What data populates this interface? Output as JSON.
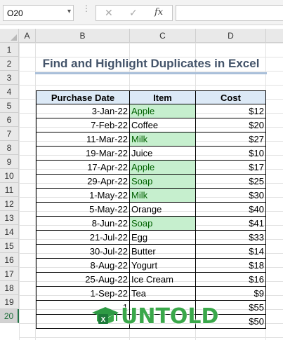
{
  "formula_bar": {
    "name_box": "O20",
    "fx_label": "fx",
    "formula_value": ""
  },
  "columns": [
    "A",
    "B",
    "C",
    "D"
  ],
  "rows": [
    "1",
    "2",
    "3",
    "4",
    "5",
    "6",
    "7",
    "8",
    "9",
    "10",
    "11",
    "12",
    "13",
    "14",
    "15",
    "16",
    "17",
    "18",
    "19",
    "20"
  ],
  "selected_row": "20",
  "sheet": {
    "title": "Find and Highlight Duplicates in Excel",
    "headers": {
      "purchase_date": "Purchase Date",
      "item": "Item",
      "cost": "Cost"
    },
    "records": [
      {
        "date": "3-Jan-22",
        "item": "Apple",
        "cost": "$12",
        "duplicate": true
      },
      {
        "date": "7-Feb-22",
        "item": "Coffee",
        "cost": "$20",
        "duplicate": false
      },
      {
        "date": "11-Mar-22",
        "item": "Milk",
        "cost": "$27",
        "duplicate": true
      },
      {
        "date": "19-Mar-22",
        "item": "Juice",
        "cost": "$10",
        "duplicate": false
      },
      {
        "date": "17-Apr-22",
        "item": "Apple",
        "cost": "$17",
        "duplicate": true
      },
      {
        "date": "29-Apr-22",
        "item": "Soap",
        "cost": "$25",
        "duplicate": true
      },
      {
        "date": "1-May-22",
        "item": "Milk",
        "cost": "$30",
        "duplicate": true
      },
      {
        "date": "5-May-22",
        "item": "Orange",
        "cost": "$40",
        "duplicate": false
      },
      {
        "date": "8-Jun-22",
        "item": "Soap",
        "cost": "$41",
        "duplicate": true
      },
      {
        "date": "21-Jul-22",
        "item": "Egg",
        "cost": "$33",
        "duplicate": false
      },
      {
        "date": "30-Jul-22",
        "item": "Butter",
        "cost": "$14",
        "duplicate": false
      },
      {
        "date": "8-Aug-22",
        "item": "Yogurt",
        "cost": "$18",
        "duplicate": false
      },
      {
        "date": "25-Aug-22",
        "item": "Ice Cream",
        "cost": "$16",
        "duplicate": false
      },
      {
        "date": "1-Sep-22",
        "item": "Tea",
        "cost": "$9",
        "duplicate": false
      },
      {
        "date": "1",
        "item": "",
        "cost": "$55",
        "duplicate": false
      },
      {
        "date": "",
        "item": "",
        "cost": "$50",
        "duplicate": false
      }
    ]
  },
  "watermark": {
    "text": "UNTOLD"
  },
  "colors": {
    "title": "#44546a",
    "header_fill": "#dce9f6",
    "duplicate_fill": "#c6efce",
    "duplicate_text": "#006100",
    "logo_green": "#3aa84a"
  }
}
